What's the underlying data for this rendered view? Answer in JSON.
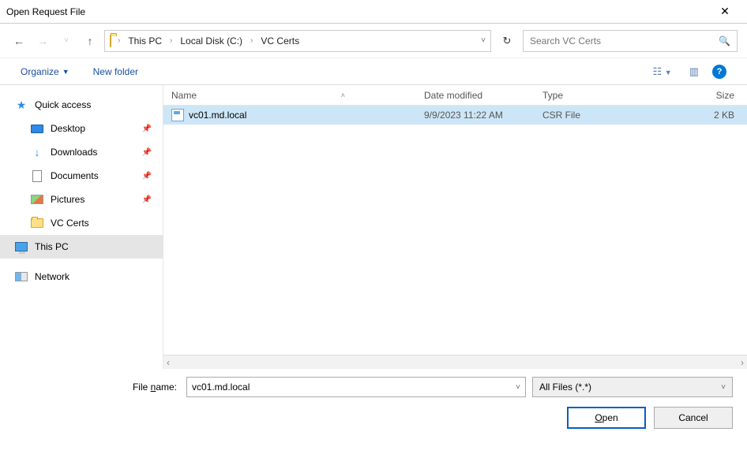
{
  "window": {
    "title": "Open Request File"
  },
  "breadcrumb": {
    "segments": [
      "This PC",
      "Local Disk (C:)",
      "VC Certs"
    ]
  },
  "search": {
    "placeholder": "Search VC Certs"
  },
  "toolbar": {
    "organize_label": "Organize",
    "new_folder_label": "New folder"
  },
  "sidebar": {
    "quick_access": "Quick access",
    "desktop": "Desktop",
    "downloads": "Downloads",
    "documents": "Documents",
    "pictures": "Pictures",
    "vc_certs": "VC Certs",
    "this_pc": "This PC",
    "network": "Network"
  },
  "columns": {
    "name": "Name",
    "date": "Date modified",
    "type": "Type",
    "size": "Size"
  },
  "files": [
    {
      "name": "vc01.md.local",
      "date": "9/9/2023 11:22 AM",
      "type": "CSR File",
      "size": "2 KB"
    }
  ],
  "footer": {
    "filename_label": "File name:",
    "filename_value": "vc01.md.local",
    "filter_label": "All Files (*.*)",
    "open_label": "Open",
    "cancel_label": "Cancel"
  }
}
